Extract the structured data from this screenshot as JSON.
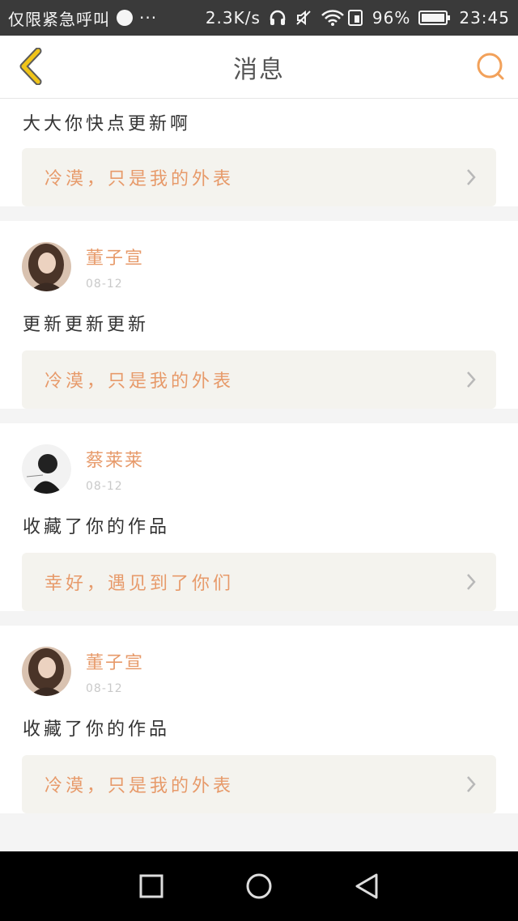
{
  "status_bar": {
    "carrier": "仅限紧急呼叫",
    "more": "···",
    "speed": "2.3K/s",
    "battery_percent": "96%",
    "time": "23:45"
  },
  "header": {
    "title": "消息"
  },
  "colors": {
    "accent": "#e79a6a",
    "back_icon": "#f0c419",
    "search_icon": "#f2a15a",
    "ref_bg": "#f4f3ee"
  },
  "messages": [
    {
      "text": "大大你快点更新啊",
      "ref_title": "冷漠，只是我的外表"
    },
    {
      "username": "董子宣",
      "date": "08-12",
      "avatar": "avatar-girl-long-hair",
      "text": "更新更新更新",
      "ref_title": "冷漠，只是我的外表"
    },
    {
      "username": "蔡莱莱",
      "date": "08-12",
      "avatar": "avatar-dark-sketch",
      "text": "收藏了你的作品",
      "ref_title": "幸好，遇见到了你们"
    },
    {
      "username": "董子宣",
      "date": "08-12",
      "avatar": "avatar-girl-long-hair",
      "text": "收藏了你的作品",
      "ref_title": "冷漠，只是我的外表"
    }
  ]
}
